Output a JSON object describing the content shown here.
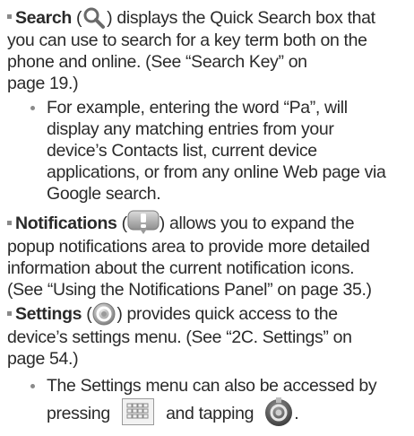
{
  "search": {
    "title": "Search",
    "open": " (",
    "close": ") displays the Quick Search box that",
    "line2": "you can use to search for a key term both on the",
    "line3": "phone and online. (See “Search Key” on",
    "line4": "page 19.)",
    "icon": "magnifier-icon"
  },
  "search_example": {
    "line1": "For example, entering the word “Pa”, will",
    "line2": "display any matching entries from your",
    "line3": "device’s Contacts list, current device",
    "line4": "applications, or from any online Web page via",
    "line5": "Google search."
  },
  "notifications": {
    "title": "Notifications",
    "open": " (",
    "close": ") allows you to expand the",
    "line2": "popup notifications area to provide more detailed",
    "line3": "information about the current notification icons.",
    "line4": "(See “Using the Notifications Panel” on page 35.)",
    "icon": "notification-bubble-icon"
  },
  "settings": {
    "title": "Settings",
    "open": " (",
    "close": ") provides quick access to the",
    "line2": "device’s settings menu. (See “2C. Settings” on",
    "line3": "page 54.)",
    "icon": "settings-gear-icon"
  },
  "settings_note": {
    "line1": "The Settings menu can also be accessed by",
    "line2a": "pressing",
    "line2b": "and tapping",
    "line2c": ".",
    "icon1": "menu-key-icon",
    "icon2": "settings-app-icon"
  }
}
